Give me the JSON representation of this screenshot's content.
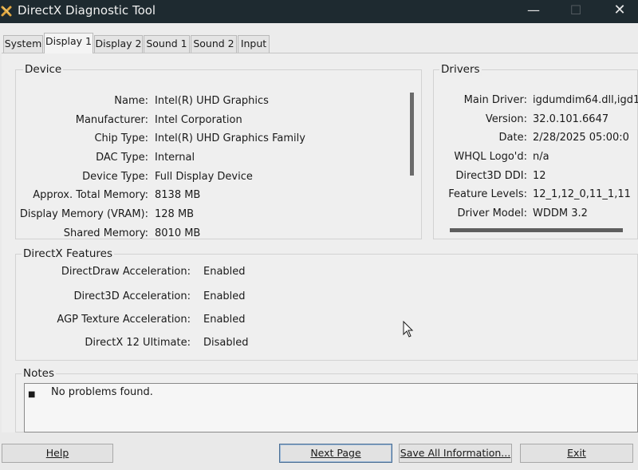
{
  "window": {
    "title": "DirectX Diagnostic Tool",
    "icons": {
      "app": "directx-x-icon",
      "minimize": "minimize-icon",
      "maximize": "maximize-icon",
      "close": "close-icon"
    },
    "minimize_glyph": "—",
    "maximize_glyph": "☐",
    "close_glyph": "✕"
  },
  "tabs": [
    {
      "label": "System",
      "active": false
    },
    {
      "label": "Display 1",
      "active": true
    },
    {
      "label": "Display 2",
      "active": false
    },
    {
      "label": "Sound 1",
      "active": false
    },
    {
      "label": "Sound 2",
      "active": false
    },
    {
      "label": "Input",
      "active": false
    }
  ],
  "device": {
    "title": "Device",
    "rows": [
      {
        "label": "Name:",
        "value": "Intel(R) UHD Graphics"
      },
      {
        "label": "Manufacturer:",
        "value": "Intel Corporation"
      },
      {
        "label": "Chip Type:",
        "value": "Intel(R) UHD Graphics Family"
      },
      {
        "label": "DAC Type:",
        "value": "Internal"
      },
      {
        "label": "Device Type:",
        "value": "Full Display Device"
      },
      {
        "label": "Approx. Total Memory:",
        "value": "8138 MB"
      },
      {
        "label": "Display Memory (VRAM):",
        "value": "128 MB"
      },
      {
        "label": "Shared Memory:",
        "value": "8010 MB"
      }
    ]
  },
  "drivers": {
    "title": "Drivers",
    "rows": [
      {
        "label": "Main Driver:",
        "value": "igdumdim64.dll,igd1"
      },
      {
        "label": "Version:",
        "value": "32.0.101.6647"
      },
      {
        "label": "Date:",
        "value": "2/28/2025 05:00:0"
      },
      {
        "label": "WHQL Logo'd:",
        "value": "n/a"
      },
      {
        "label": "Direct3D DDI:",
        "value": "12"
      },
      {
        "label": "Feature Levels:",
        "value": "12_1,12_0,11_1,11"
      },
      {
        "label": "Driver Model:",
        "value": "WDDM 3.2"
      }
    ]
  },
  "directx_features": {
    "title": "DirectX Features",
    "rows": [
      {
        "label": "DirectDraw Acceleration:",
        "value": "Enabled"
      },
      {
        "label": "Direct3D Acceleration:",
        "value": "Enabled"
      },
      {
        "label": "AGP Texture Acceleration:",
        "value": "Enabled"
      },
      {
        "label": "DirectX 12 Ultimate:",
        "value": "Disabled"
      }
    ]
  },
  "notes": {
    "title": "Notes",
    "bullet": "■",
    "text": "No problems found."
  },
  "buttons": {
    "help": "Help",
    "next_page": "Next Page",
    "save_all": "Save All Information...",
    "exit": "Exit"
  }
}
